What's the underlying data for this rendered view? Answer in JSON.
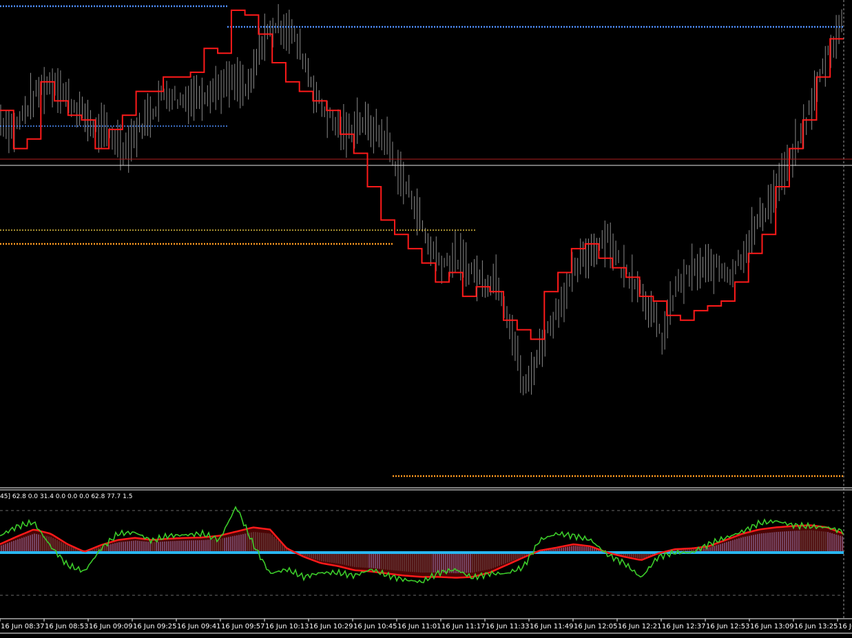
{
  "colors": {
    "background": "#000000",
    "price_bars": "#8a8a8a",
    "step_line": "#ff1a1a",
    "level_blue": "#4f8fff",
    "level_yellow": "#e0c040",
    "level_orange": "#ff9a20",
    "hline_white": "#e8e8e8",
    "hline_red": "#b02020",
    "osc_green": "#3ccc2a",
    "osc_red_line": "#ff1a1a",
    "hist_blue": "#5b8ed0",
    "hist_dark": "#2e5a5a",
    "hist_red": "#8a0a0a",
    "zero_cyan": "#29b6f0",
    "grid": "#6a6a6a"
  },
  "indicator": {
    "label": "45] 62.8 0.0 31.4 0.0 0.0 0.0 62.8 77.7 1.5"
  },
  "chart_data": [
    {
      "type": "line",
      "panel": "price",
      "x_ticks": [
        "16 Jun 08:37",
        "16 Jun 08:53",
        "16 Jun 09:09",
        "16 Jun 09:25",
        "16 Jun 09:41",
        "16 Jun 09:57",
        "16 Jun 10:13",
        "16 Jun 10:29",
        "16 Jun 10:45",
        "16 Jun 11:01",
        "16 Jun 11:17",
        "16 Jun 11:33",
        "16 Jun 11:49",
        "16 Jun 12:05",
        "16 Jun 12:21",
        "16 Jun 12:37",
        "16 Jun 12:53",
        "16 Jun 13:09",
        "16 Jun 13:25",
        "16 Ju"
      ],
      "ylim": [
        0,
        100
      ],
      "series": [
        {
          "role": "step-line",
          "values": [
            78,
            70,
            72,
            84,
            80,
            77,
            76,
            70,
            74,
            77,
            82,
            82,
            85,
            85,
            86,
            91,
            90,
            99,
            98,
            94,
            88,
            84,
            82,
            80,
            78,
            73,
            69,
            62,
            55,
            52,
            49,
            46,
            42,
            44,
            39,
            41,
            40,
            34,
            32,
            30,
            40,
            44,
            49,
            50,
            47,
            45,
            43,
            39,
            38,
            35,
            34,
            36,
            37,
            38,
            42,
            48,
            52,
            62,
            70,
            76,
            85,
            93
          ]
        },
        {
          "role": "price",
          "values": [
            76,
            74,
            79,
            83,
            84,
            80,
            77,
            74,
            73,
            70,
            74,
            78,
            82,
            80,
            81,
            82,
            83,
            84,
            82,
            93,
            96,
            95,
            89,
            80,
            76,
            73,
            76,
            74,
            72,
            64,
            59,
            50,
            46,
            47,
            45,
            42,
            43,
            33,
            19,
            27,
            34,
            40,
            46,
            49,
            52,
            45,
            43,
            37,
            30,
            41,
            44,
            45,
            45,
            44,
            49,
            55,
            60,
            66,
            72,
            81,
            90,
            96
          ]
        }
      ]
    },
    {
      "type": "area",
      "panel": "oscillator",
      "ylim": [
        -100,
        100
      ],
      "series": [
        {
          "role": "signal-red",
          "values": [
            20,
            38,
            55,
            45,
            20,
            2,
            18,
            30,
            35,
            30,
            33,
            35,
            36,
            40,
            50,
            60,
            55,
            10,
            -10,
            -25,
            -32,
            -42,
            -45,
            -50,
            -55,
            -58,
            -58,
            -60,
            -58,
            -48,
            -30,
            -12,
            5,
            12,
            20,
            15,
            0,
            -10,
            -18,
            -2,
            8,
            10,
            15,
            30,
            45,
            55,
            60,
            63,
            65,
            60,
            45
          ]
        },
        {
          "role": "oscillator-green",
          "values": [
            40,
            62,
            72,
            15,
            -30,
            -45,
            10,
            45,
            48,
            28,
            40,
            42,
            45,
            30,
            110,
            20,
            -50,
            -40,
            -58,
            -48,
            -48,
            -55,
            -40,
            -55,
            -65,
            -70,
            -48,
            -40,
            -60,
            -50,
            -50,
            -35,
            30,
            45,
            40,
            30,
            -5,
            -25,
            -60,
            -10,
            0,
            0,
            20,
            35,
            50,
            70,
            75,
            65,
            62,
            60,
            50
          ]
        }
      ]
    }
  ]
}
